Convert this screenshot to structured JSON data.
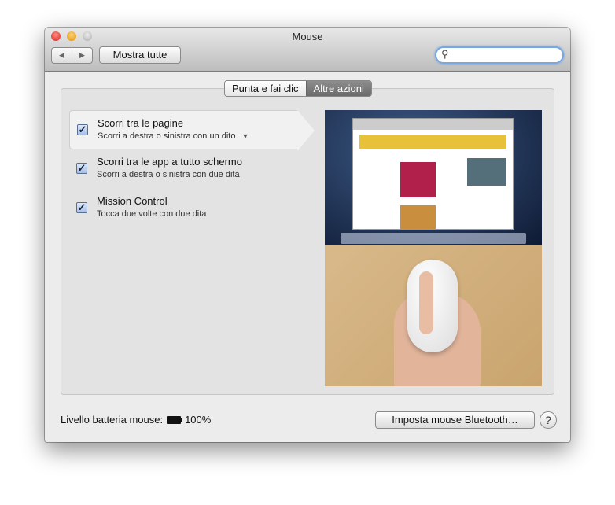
{
  "window": {
    "title": "Mouse"
  },
  "toolbar": {
    "back": "◀",
    "forward": "▶",
    "show_all": "Mostra tutte",
    "search_placeholder": "",
    "search_icon": "⚲"
  },
  "tabs": [
    {
      "label": "Punta e fai clic",
      "selected": false
    },
    {
      "label": "Altre azioni",
      "selected": true
    }
  ],
  "options": [
    {
      "title": "Scorri tra le pagine",
      "subtitle": "Scorri a destra o sinistra con un dito",
      "checked": true,
      "has_menu": true
    },
    {
      "title": "Scorri tra le app a tutto schermo",
      "subtitle": "Scorri a destra o sinistra con due dita",
      "checked": true
    },
    {
      "title": "Mission Control",
      "subtitle": "Tocca due volte con due dita",
      "checked": true
    }
  ],
  "footer": {
    "battery_label": "Livello batteria mouse:",
    "battery_value": "100%",
    "bluetooth_button": "Imposta mouse Bluetooth…",
    "help": "?"
  },
  "check_glyph": "✓",
  "menu_glyph": "▼"
}
